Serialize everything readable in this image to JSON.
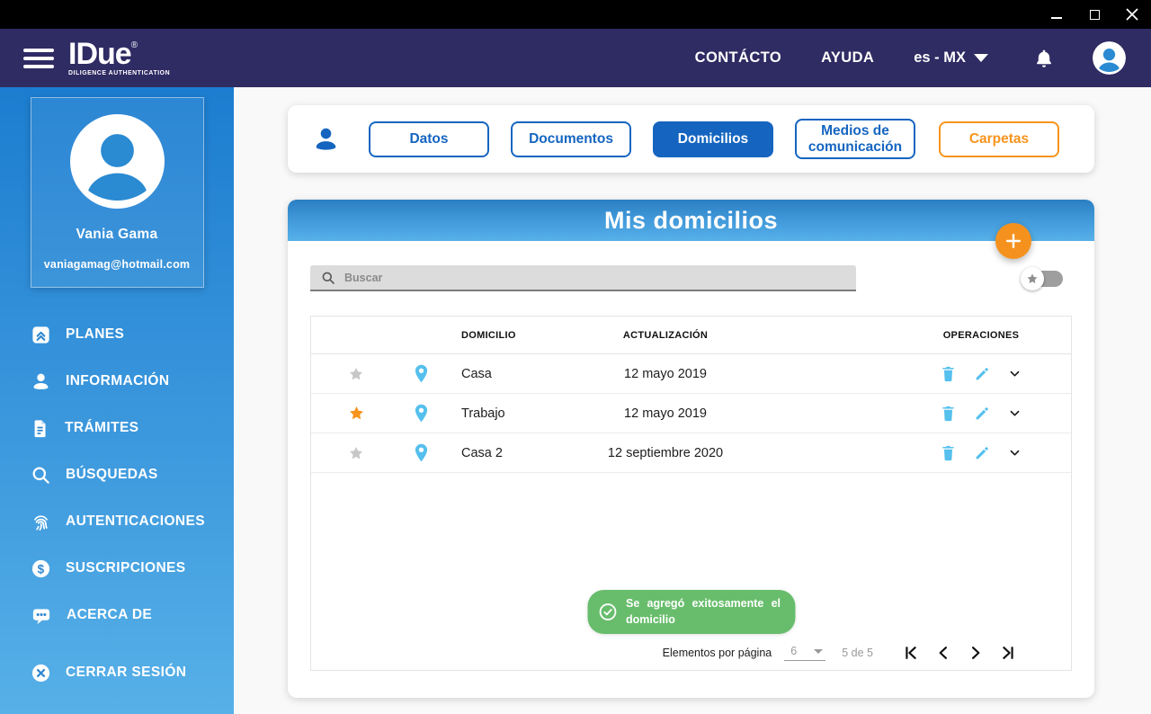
{
  "window": {
    "controls": [
      "minimize-icon",
      "maximize-icon",
      "close-icon"
    ]
  },
  "navbar": {
    "logo": {
      "name": "IDue",
      "registered": "®",
      "tagline": "DILIGENCE AUTHENTICATION"
    },
    "links": {
      "contact": "CONTÁCTO",
      "help": "AYUDA"
    },
    "language": "es - MX",
    "icons": [
      "hamburger-icon",
      "bell-icon",
      "avatar"
    ]
  },
  "sidebar": {
    "profile": {
      "name": "Vania Gama",
      "email": "vaniagamag@hotmail.com"
    },
    "items": [
      {
        "label": "PLANES",
        "icon": "plans-icon"
      },
      {
        "label": "INFORMACIÓN",
        "icon": "person-icon"
      },
      {
        "label": "TRÁMITES",
        "icon": "document-icon"
      },
      {
        "label": "BÚSQUEDAS",
        "icon": "search-icon"
      },
      {
        "label": "AUTENTICACIONES",
        "icon": "fingerprint-icon"
      },
      {
        "label": "SUSCRIPCIONES",
        "icon": "dollar-circle-icon"
      },
      {
        "label": "ACERCA DE",
        "icon": "chat-icon"
      }
    ],
    "logout": {
      "label": "CERRAR SESIÓN",
      "icon": "circle-x-icon"
    }
  },
  "tabs": {
    "items": [
      {
        "label": "Datos",
        "active": false
      },
      {
        "label": "Documentos",
        "active": false
      },
      {
        "label": "Domicilios",
        "active": true
      },
      {
        "label": "Medios de comunicación",
        "active": false
      },
      {
        "label": "Carpetas",
        "active": false,
        "accent": "orange"
      }
    ]
  },
  "card": {
    "title": "Mis domicilios",
    "add_button": "plus-icon",
    "search_placeholder": "Buscar",
    "favorites_filter_on": false,
    "table": {
      "headers": [
        "DOMICILIO",
        "ACTUALIZACIÓN",
        "OPERACIONES"
      ],
      "rows": [
        {
          "favorite": false,
          "name": "Casa",
          "updated": "12 mayo 2019"
        },
        {
          "favorite": true,
          "name": "Trabajo",
          "updated": "12 mayo 2019"
        },
        {
          "favorite": false,
          "name": "Casa 2",
          "updated": "12 septiembre 2020"
        }
      ],
      "row_icons": [
        "star-icon",
        "location-pin-icon",
        "trash-icon",
        "edit-pencil-icon",
        "chevron-down-icon"
      ]
    },
    "toast": {
      "message": "Se agregó exitosamente el domicilio",
      "icon": "check-circle-icon"
    },
    "pagination": {
      "items_label": "Elementos por página",
      "per_page": "6",
      "range_label": "5 de 5",
      "nav_icons": [
        "first-page-icon",
        "prev-page-icon",
        "next-page-icon",
        "last-page-icon"
      ]
    }
  },
  "colors": {
    "navy_header": "#2f2b63",
    "primary_blue": "#1565c0",
    "sidebar_top": "#1c7dd0",
    "sidebar_bottom": "#57b0e7",
    "accent_orange": "#f5921e",
    "light_icon_blue": "#55c0ed",
    "success_green": "#68bd6c",
    "favorite_orange": "#f7941d",
    "inactive_star_gray": "#c7c7c7"
  }
}
